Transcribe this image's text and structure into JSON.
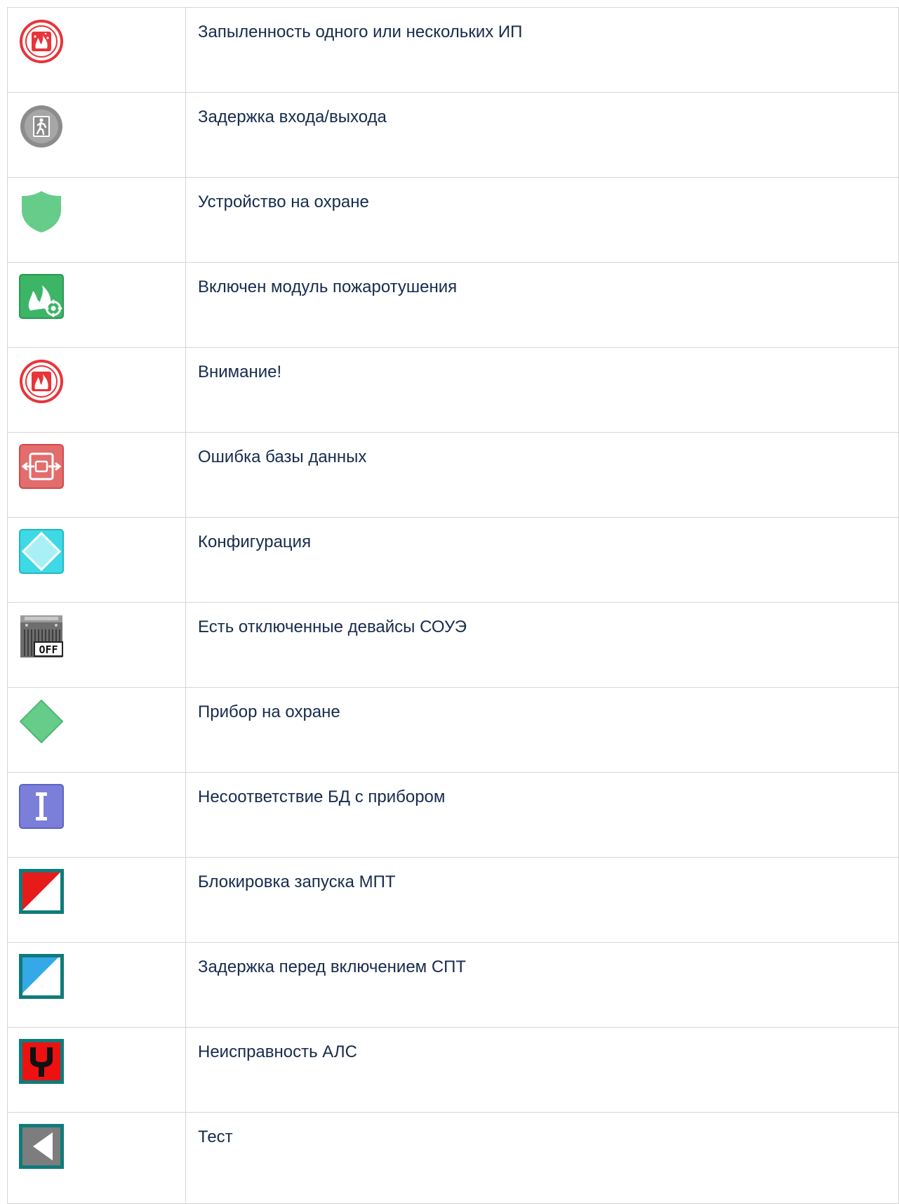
{
  "rows": [
    {
      "icon": "smoke-detector-dust-icon",
      "text": "Запыленность одного или нескольких ИП"
    },
    {
      "icon": "entry-exit-delay-icon",
      "text": "Задержка входа/выхода"
    },
    {
      "icon": "armed-shield-icon",
      "text": "Устройство на охране"
    },
    {
      "icon": "fire-suppression-module-icon",
      "text": "Включен модуль пожаротушения"
    },
    {
      "icon": "fire-attention-icon",
      "text": "Внимание!"
    },
    {
      "icon": "database-error-icon",
      "text": "Ошибка базы данных"
    },
    {
      "icon": "configuration-icon",
      "text": "Конфигурация"
    },
    {
      "icon": "disabled-devices-off-icon",
      "text": "Есть отключенные девайсы СОУЭ",
      "badge": "OFF"
    },
    {
      "icon": "device-armed-diamond-icon",
      "text": "Прибор на охране"
    },
    {
      "icon": "db-mismatch-icon",
      "text": "Несоответствие БД с прибором"
    },
    {
      "icon": "launch-block-icon",
      "text": "Блокировка запуска МПТ"
    },
    {
      "icon": "spt-delay-icon",
      "text": "Задержка перед включением СПТ"
    },
    {
      "icon": "als-fault-icon",
      "text": "Неисправность АЛС"
    },
    {
      "icon": "test-icon",
      "text": "Тест"
    }
  ],
  "colors": {
    "fire_red": "#e8343a",
    "gray": "#8c8c8c",
    "green": "#66cc8a",
    "suppression_green": "#3cb567",
    "db_red": "#e36c6c",
    "cyan": "#3fd9e6",
    "violet": "#7b7fd9",
    "teal_frame": "#0f7b7b",
    "text": "#172b4d"
  }
}
